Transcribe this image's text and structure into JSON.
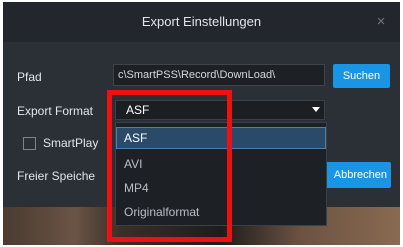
{
  "dialog": {
    "title": "Export Einstellungen",
    "close_glyph": "×"
  },
  "path": {
    "label": "Pfad",
    "value": "c\\SmartPSS\\Record\\DownLoad\\",
    "browse_label": "Suchen"
  },
  "format": {
    "label": "Export Format",
    "selected": "ASF",
    "options": [
      "ASF",
      "AVI",
      "MP4",
      "Originalformat"
    ],
    "arrow_icon": "chevron-down-icon"
  },
  "smartplayer": {
    "label": "SmartPlay",
    "checked": false
  },
  "free_space": {
    "label": "Freier Speiche"
  },
  "cancel_label": "Abbrechen",
  "colors": {
    "dialog_bg": "#2b3036",
    "accent": "#1a95e6",
    "highlight": "#ee1111"
  }
}
